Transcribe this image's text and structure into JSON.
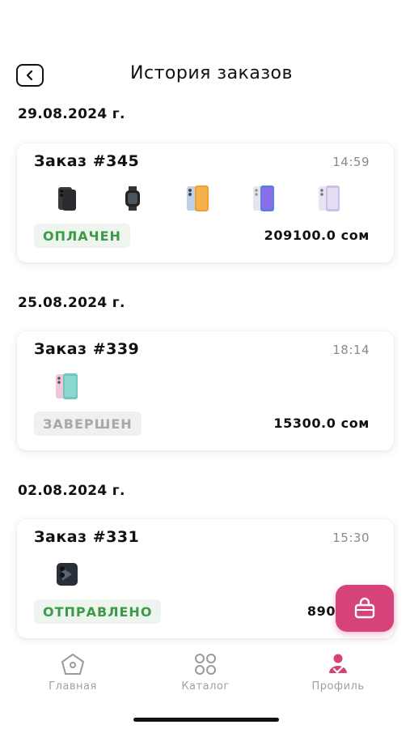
{
  "header": {
    "title": "История заказов"
  },
  "groups": [
    {
      "date": "29.08.2024 г.",
      "order": {
        "number": "Заказ #345",
        "time": "14:59",
        "items": [
          "smartphone-black-icon",
          "smartwatch-icon",
          "smartphone-orange-icon",
          "smartphone-blue-icon",
          "smartphone-lavender-icon"
        ],
        "status": "ОПЛАЧЕН",
        "status_color": "#3c9a46",
        "total": "209100.0 сом"
      }
    },
    {
      "date": "25.08.2024 г.",
      "order": {
        "number": "Заказ #339",
        "time": "18:14",
        "items": [
          "smartphone-pink-icon"
        ],
        "status": "ЗАВЕРШЕН",
        "status_color": "#a8a8a8",
        "total": "15300.0 сом"
      }
    },
    {
      "date": "02.08.2024 г.",
      "order": {
        "number": "Заказ #331",
        "time": "15:30",
        "items": [
          "smartphone-titanium-icon"
        ],
        "status": "ОТПРАВЛЕНО",
        "status_color": "#3c9a46",
        "total": "89000.0"
      }
    }
  ],
  "tabs": [
    {
      "label": "Главная",
      "icon": "home-icon"
    },
    {
      "label": "Каталог",
      "icon": "catalog-icon"
    },
    {
      "label": "Профиль",
      "icon": "profile-icon",
      "active": true
    }
  ],
  "colors": {
    "accent": "#d6427a",
    "success": "#3c9a46",
    "muted": "#a0a0a0"
  }
}
